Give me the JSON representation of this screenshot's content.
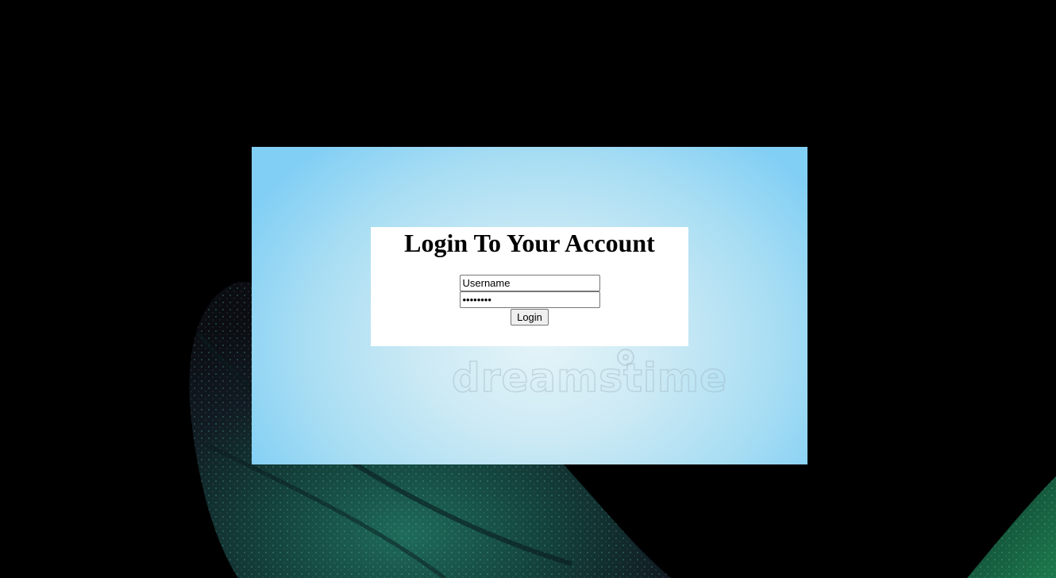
{
  "login": {
    "title": "Login To Your Account",
    "username_value": "Username",
    "password_value": "••••••••",
    "button_label": "Login"
  },
  "background": {
    "watermark_text": "dreamstime"
  },
  "colors": {
    "page_background": "#000000",
    "panel_gradient_center": "#e4f4f8",
    "panel_gradient_edge": "#82cff5",
    "login_box_background": "#ffffff"
  }
}
